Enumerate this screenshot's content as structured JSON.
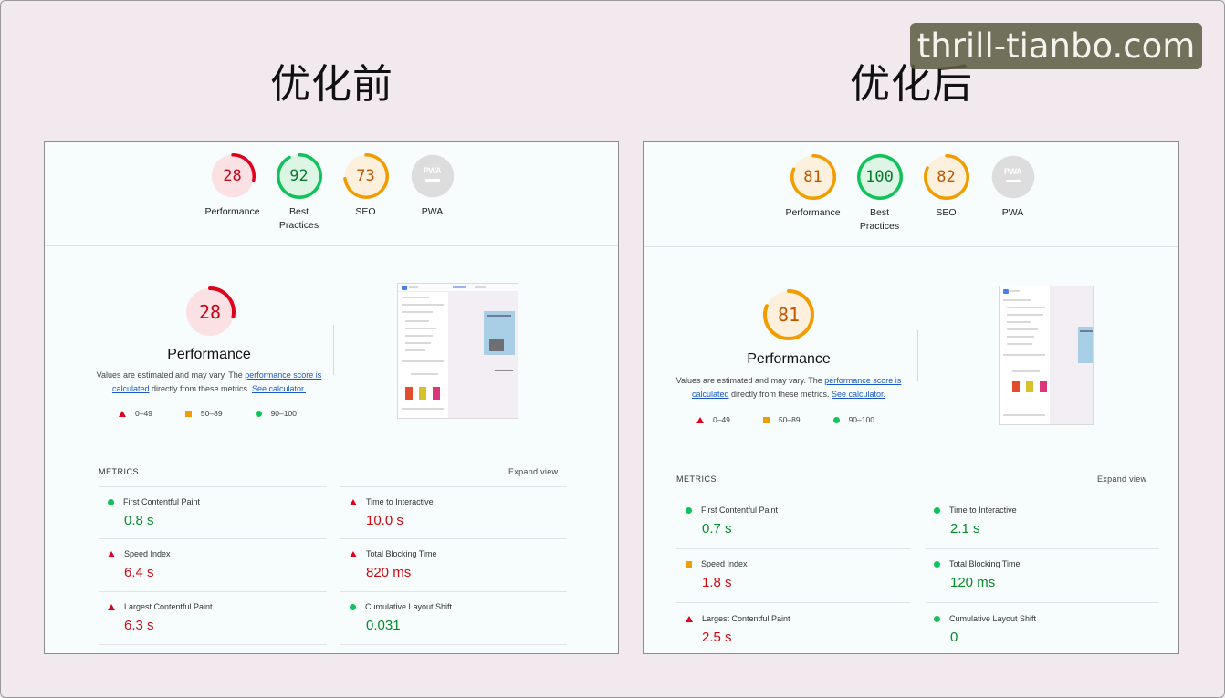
{
  "headings": {
    "before": "优化前",
    "after": "优化后"
  },
  "watermark": "thrill-tianbo.com",
  "colors": {
    "fail": "#e0001b",
    "average": "#f29c00",
    "pass": "#0fc35a",
    "na": "#dddddd"
  },
  "icons": {
    "fail": "triangle",
    "average": "square",
    "pass": "circle"
  },
  "before": {
    "gauges": [
      {
        "score": "28",
        "label": "Performance",
        "status": "fail",
        "fraction": 0.28
      },
      {
        "score": "92",
        "label": "Best Practices",
        "status": "pass",
        "fraction": 0.92
      },
      {
        "score": "73",
        "label": "SEO",
        "status": "average",
        "fraction": 0.73
      },
      {
        "score": "",
        "label": "PWA",
        "status": "na",
        "badge": "PWA"
      }
    ],
    "perf": {
      "score": "28",
      "fraction": 0.28,
      "status": "fail",
      "title": "Performance",
      "desc_pre": "Values are estimated and may vary. The ",
      "desc_link1": "performance score is calculated",
      "desc_mid": " directly from these metrics. ",
      "desc_link2": "See calculator."
    },
    "legend": [
      "0–49",
      "50–89",
      "90–100"
    ],
    "metrics_title": "METRICS",
    "expand": "Expand view",
    "metrics": [
      {
        "name": "First Contentful Paint",
        "value": "0.8 s",
        "status": "pass"
      },
      {
        "name": "Time to Interactive",
        "value": "10.0 s",
        "status": "fail"
      },
      {
        "name": "Speed Index",
        "value": "6.4 s",
        "status": "fail"
      },
      {
        "name": "Total Blocking Time",
        "value": "820 ms",
        "status": "fail"
      },
      {
        "name": "Largest Contentful Paint",
        "value": "6.3 s",
        "status": "fail"
      },
      {
        "name": "Cumulative Layout Shift",
        "value": "0.031",
        "status": "pass"
      }
    ]
  },
  "after": {
    "gauges": [
      {
        "score": "81",
        "label": "Performance",
        "status": "average",
        "fraction": 0.81
      },
      {
        "score": "100",
        "label": "Best Practices",
        "status": "pass",
        "fraction": 1.0
      },
      {
        "score": "82",
        "label": "SEO",
        "status": "average",
        "fraction": 0.82
      },
      {
        "score": "",
        "label": "PWA",
        "status": "na",
        "badge": "PWA"
      }
    ],
    "perf": {
      "score": "81",
      "fraction": 0.81,
      "status": "average",
      "title": "Performance",
      "desc_pre": "Values are estimated and may vary. The ",
      "desc_link1": "performance score is calculated",
      "desc_mid": " directly from these metrics. ",
      "desc_link2": "See calculator."
    },
    "legend": [
      "0–49",
      "50–89",
      "90–100"
    ],
    "metrics_title": "METRICS",
    "expand": "Expand view",
    "metrics": [
      {
        "name": "First Contentful Paint",
        "value": "0.7 s",
        "status": "pass"
      },
      {
        "name": "Time to Interactive",
        "value": "2.1 s",
        "status": "pass"
      },
      {
        "name": "Speed Index",
        "value": "1.8 s",
        "status": "average"
      },
      {
        "name": "Total Blocking Time",
        "value": "120 ms",
        "status": "pass"
      },
      {
        "name": "Largest Contentful Paint",
        "value": "2.5 s",
        "status": "fail"
      },
      {
        "name": "Cumulative Layout Shift",
        "value": "0",
        "status": "pass"
      }
    ]
  }
}
